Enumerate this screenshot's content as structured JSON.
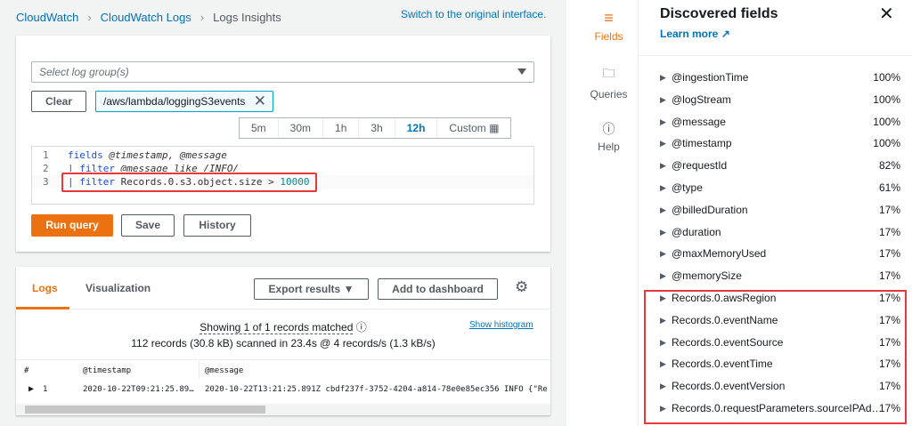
{
  "breadcrumb": [
    "CloudWatch",
    "CloudWatch Logs",
    "Logs Insights"
  ],
  "switch_link": "Switch to the original interface.",
  "query": {
    "log_group_placeholder": "Select log group(s)",
    "clear_label": "Clear",
    "selected_group": "/aws/lambda/loggingS3events",
    "time_ranges": [
      "5m",
      "30m",
      "1h",
      "3h",
      "12h",
      "Custom"
    ],
    "active_range": "12h",
    "lines": [
      {
        "n": "1",
        "kw": "fields",
        "rest": " @timestamp, @message"
      },
      {
        "n": "2",
        "kw": "| filter",
        "rest": " @message like /INFO/"
      },
      {
        "n": "3",
        "kw": "| filter",
        "rest": " Records.0.s3.object.size > ",
        "num": "10000"
      }
    ],
    "run_label": "Run query",
    "save_label": "Save",
    "history_label": "History"
  },
  "results": {
    "tabs": [
      "Logs",
      "Visualization"
    ],
    "export_label": "Export results",
    "dashboard_label": "Add to dashboard",
    "showing": "Showing 1 of 1 records matched",
    "scanned": "112 records (30.8 kB) scanned in 23.4s @ 4 records/s (1.3 kB/s)",
    "histogram_link": "Show histogram",
    "columns": [
      "#",
      "@timestamp",
      "@message"
    ],
    "rows": [
      {
        "n": "1",
        "timestamp": "2020-10-22T09:21:25.89…",
        "message": "2020-10-22T13:21:25.891Z cbdf237f-3752-4204-a814-78e0e85ec356 INFO {\"Re"
      }
    ]
  },
  "rail": [
    {
      "label": "Fields"
    },
    {
      "label": "Queries"
    },
    {
      "label": "Help"
    }
  ],
  "panel": {
    "title": "Discovered fields",
    "learn_more": "Learn more",
    "fields": [
      {
        "name": "@ingestionTime",
        "pct": "100%"
      },
      {
        "name": "@logStream",
        "pct": "100%"
      },
      {
        "name": "@message",
        "pct": "100%"
      },
      {
        "name": "@timestamp",
        "pct": "100%"
      },
      {
        "name": "@requestId",
        "pct": "82%"
      },
      {
        "name": "@type",
        "pct": "61%"
      },
      {
        "name": "@billedDuration",
        "pct": "17%"
      },
      {
        "name": "@duration",
        "pct": "17%"
      },
      {
        "name": "@maxMemoryUsed",
        "pct": "17%"
      },
      {
        "name": "@memorySize",
        "pct": "17%"
      },
      {
        "name": "Records.0.awsRegion",
        "pct": "17%"
      },
      {
        "name": "Records.0.eventName",
        "pct": "17%"
      },
      {
        "name": "Records.0.eventSource",
        "pct": "17%"
      },
      {
        "name": "Records.0.eventTime",
        "pct": "17%"
      },
      {
        "name": "Records.0.eventVersion",
        "pct": "17%"
      },
      {
        "name": "Records.0.requestParameters.sourceIPAd…",
        "pct": "17%"
      }
    ]
  }
}
